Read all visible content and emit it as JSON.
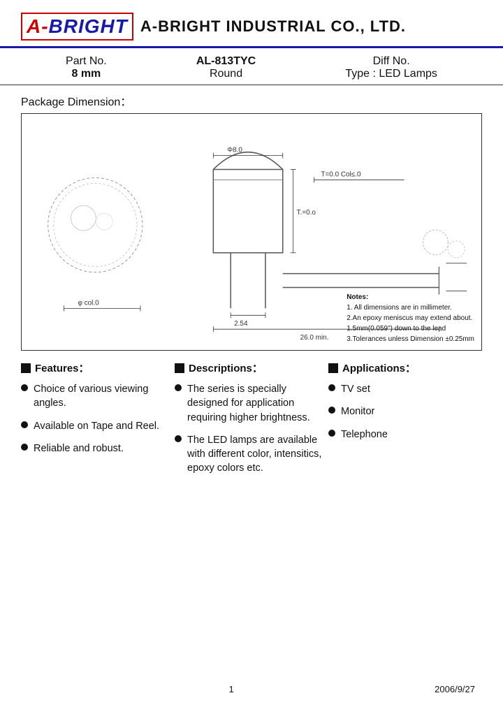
{
  "header": {
    "logo_a": "A-",
    "logo_bright": "BRIGHT",
    "company_name": "A-BRIGHT INDUSTRIAL CO., LTD."
  },
  "part_info": {
    "label1": "Part No.",
    "value1": "AL-813TYC",
    "label2": "8 mm",
    "sub_label2": "Round",
    "label3": "Diff No.",
    "value3": "Type : LED Lamps"
  },
  "package": {
    "title": "Package Dimension："
  },
  "notes": {
    "title": "Notes:",
    "line1": "1. All dimensions are in millimeter.",
    "line2": "2.An epoxy meniscus may extend about.",
    "line3": "  1.5mm(0.059\") down to the lead",
    "line4": "3.Tolerances unless Dimension ±0.25mm"
  },
  "features": {
    "header": "Features：",
    "items": [
      "Choice of various viewing angles.",
      "Available on Tape and Reel.",
      "Reliable and robust."
    ]
  },
  "descriptions": {
    "header": "Descriptions：",
    "items": [
      "The series is specially designed for application requiring higher brightness.",
      "The LED lamps are available with different color, intensitics, epoxy colors etc."
    ]
  },
  "applications": {
    "header": "Applications：",
    "items": [
      "TV set",
      "Monitor",
      "Telephone"
    ]
  },
  "footer": {
    "page": "1",
    "date": "2006/9/27"
  }
}
